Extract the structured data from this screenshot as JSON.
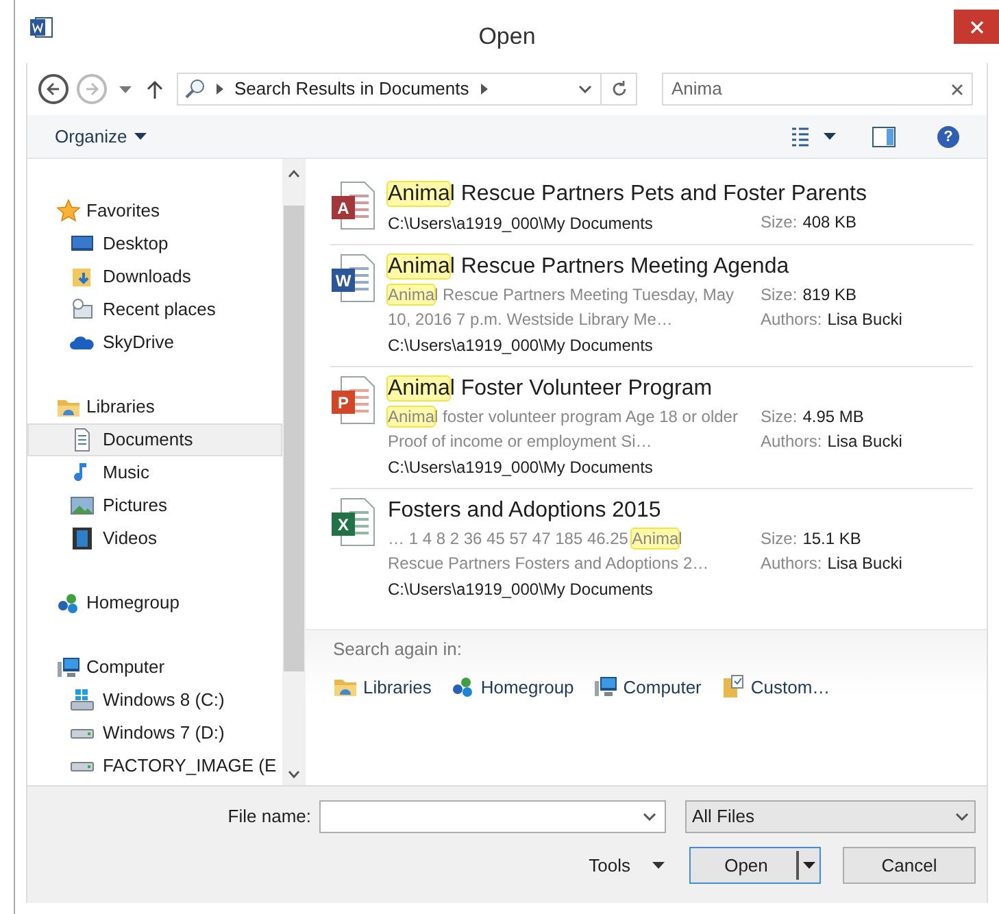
{
  "window": {
    "title": "Open"
  },
  "nav": {
    "address": "Search Results in Documents",
    "search_value": "Anima"
  },
  "toolbar": {
    "organize": "Organize",
    "help": "?"
  },
  "sidebar": {
    "groups": [
      {
        "label": "Favorites",
        "selected": false,
        "children": [
          {
            "label": "Desktop",
            "selected": false
          },
          {
            "label": "Downloads",
            "selected": false
          },
          {
            "label": "Recent places",
            "selected": false
          },
          {
            "label": "SkyDrive",
            "selected": false
          }
        ]
      },
      {
        "label": "Libraries",
        "selected": false,
        "children": [
          {
            "label": "Documents",
            "selected": true
          },
          {
            "label": "Music",
            "selected": false
          },
          {
            "label": "Pictures",
            "selected": false
          },
          {
            "label": "Videos",
            "selected": false
          }
        ]
      },
      {
        "label": "Homegroup",
        "selected": false
      },
      {
        "label": "Computer",
        "selected": false,
        "children": [
          {
            "label": "Windows 8 (C:)",
            "selected": false
          },
          {
            "label": "Windows 7 (D:)",
            "selected": false
          },
          {
            "label": "FACTORY_IMAGE (E",
            "selected": false
          }
        ]
      }
    ]
  },
  "results": [
    {
      "title": [
        {
          "text": "Anima",
          "highlighted": true
        },
        {
          "text": "l Rescue Partners Pets and Foster Parents",
          "highlighted": false
        }
      ],
      "icon_letter": "A",
      "path": "C:\\Users\\a1919_000\\My Documents",
      "size_label": "Size:",
      "size": "408 KB"
    },
    {
      "title": [
        {
          "text": "Anima",
          "highlighted": true
        },
        {
          "text": "l Rescue Partners Meeting Agenda",
          "highlighted": false
        }
      ],
      "icon_letter": "W",
      "snippet": [
        {
          "text": "Anima",
          "highlighted": true
        },
        {
          "text": "l Rescue Partners Meeting Tuesday, May 10, 2016 7 p.m. Westside Library Me…",
          "highlighted": false
        }
      ],
      "path": "C:\\Users\\a1919_000\\My Documents",
      "size_label": "Size:",
      "size": "819 KB",
      "authors_label": "Authors:",
      "authors": "Lisa Bucki"
    },
    {
      "title": [
        {
          "text": "Anima",
          "highlighted": true
        },
        {
          "text": "l Foster Volunteer Program",
          "highlighted": false
        }
      ],
      "icon_letter": "P",
      "snippet": [
        {
          "text": "Anima",
          "highlighted": true
        },
        {
          "text": "l foster volunteer program Age 18 or older Proof of income or employment Si…",
          "highlighted": false
        }
      ],
      "path": "C:\\Users\\a1919_000\\My Documents",
      "size_label": "Size:",
      "size": "4.95 MB",
      "authors_label": "Authors:",
      "authors": "Lisa Bucki"
    },
    {
      "title": [
        {
          "text": "Fosters and Adoptions 2015",
          "highlighted": false
        }
      ],
      "icon_letter": "X",
      "snippet": [
        {
          "text": "… 1 4 8 2 36 45 57 47 185 46.25 ",
          "highlighted": false
        },
        {
          "text": "Anima",
          "highlighted": true
        },
        {
          "text": "l Rescue Partners Fosters and Adoptions 2…",
          "highlighted": false
        }
      ],
      "path": "C:\\Users\\a1919_000\\My Documents",
      "size_label": "Size:",
      "size": "15.1 KB",
      "authors_label": "Authors:",
      "authors": "Lisa Bucki"
    }
  ],
  "search_again": {
    "label": "Search again in:",
    "locations": [
      "Libraries",
      "Homegroup",
      "Computer",
      "Custom…"
    ]
  },
  "footer": {
    "file_name_label": "File name:",
    "file_type": "All Files",
    "tools": "Tools",
    "open": "Open",
    "cancel": "Cancel"
  }
}
